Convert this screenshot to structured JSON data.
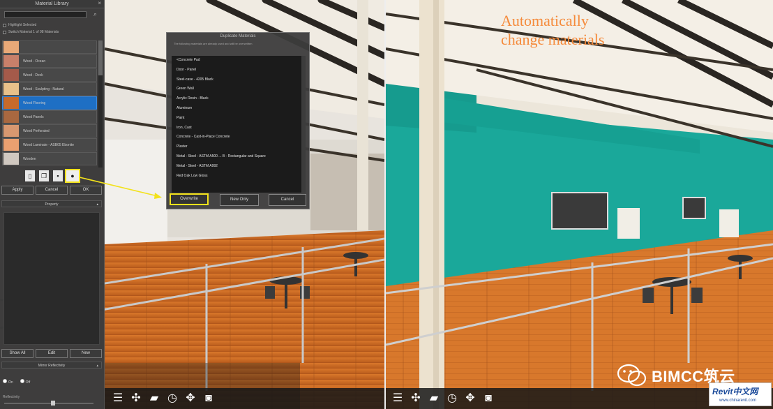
{
  "library": {
    "title": "Material Library",
    "close": "×",
    "options": [
      "Highlight Selected",
      "Switch Material 1 of 98 Materials"
    ],
    "materials": [
      {
        "label": "",
        "color": "#e9a978",
        "selected": false
      },
      {
        "label": "Wood - Ocean",
        "color": "#c8806a",
        "selected": false
      },
      {
        "label": "Wood - Deck",
        "color": "#a45a4a",
        "selected": false
      },
      {
        "label": "Wood - Sculpting - Natural",
        "color": "#e8c08a",
        "selected": false
      },
      {
        "label": "Wood Flooring",
        "color": "#c86a2a",
        "selected": true
      },
      {
        "label": "Wood Panels",
        "color": "#a86840",
        "selected": false
      },
      {
        "label": "Wood Perforated",
        "color": "#d89870",
        "selected": false
      },
      {
        "label": "Wood Laminate - ASB05 Ebonite",
        "color": "#eaa070",
        "selected": false
      },
      {
        "label": "Wooden",
        "color": "#d0c8c0",
        "selected": false
      },
      {
        "label": "",
        "color": "#d8d8d8",
        "selected": false
      }
    ],
    "icons": [
      "new-material-icon",
      "duplicate-icon",
      "save-icon",
      "eye-icon"
    ],
    "buttons": {
      "apply": "Apply",
      "cancel": "Cancel",
      "ok": "OK"
    },
    "properties_label": "Property",
    "bottom_buttons": {
      "show_all": "Show All",
      "edit": "Edit",
      "new": "New"
    },
    "mirror_label": "Mirror Reflectivity",
    "radio_on": "On",
    "radio_off": "Off",
    "reflectivity_label": "Reflectivity",
    "reflectivity_level": 0.55
  },
  "dialog": {
    "title": "Duplicate Materials",
    "subtitle": "The following materials are already used and will be overwritten",
    "items": [
      "<Concrete Pad",
      "Door - Panel",
      "Steel-case - 4205 Black",
      "Green Wall",
      "Acrylic Resin - Black",
      "Aluminum",
      "Paint",
      "Iron, Cast",
      "Concrete - Cast-in-Place Concrete",
      "Plaster",
      "Metal - Steel - ASTM A500 ... B - Rectangular and Square",
      "Metal - Steel - ASTM A992",
      "Red Oak Low Gloss"
    ],
    "buttons": {
      "overwrite": "Overwrite",
      "new_only": "New Only",
      "cancel": "Cancel"
    }
  },
  "caption": {
    "line1": "Automatically",
    "line2": "change materials"
  },
  "toolbar_icons": [
    "list-icon",
    "walk-icon",
    "folder-icon",
    "clock-icon",
    "move-icon",
    "vr-headset-icon"
  ],
  "watermark": {
    "text": "BIMCC筑云"
  },
  "logo": {
    "main": "Revit中文网",
    "sub": "www.chinarevit.com"
  },
  "colors": {
    "highlight": "#f3e21b",
    "selected": "#1e6fc4",
    "caption": "#f58a3a",
    "teal_wall": "#1aa89a",
    "floor": "#c8702a"
  }
}
